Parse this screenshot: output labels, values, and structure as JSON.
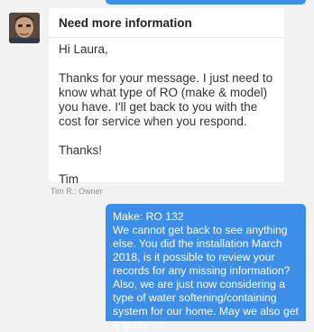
{
  "message": {
    "subject": "Need more information",
    "greeting": "Hi Laura,",
    "paragraph": "Thanks for your message. I just need to know what type of RO (make & model) you have. I'll get back to you with the cost for service when you respond.",
    "thanks": "Thanks!",
    "signature": "Tim"
  },
  "sender_meta": "Tim R.: Owner",
  "reply": {
    "text": "Make: RO 132\nWe cannot get back to see anything else. You did the installation March 2018, is it possible to review your records for any missing information?\nAlso, we are just now considering a type of water softening/containing system for our home. May we also get a quote on"
  },
  "colors": {
    "reply_bubble": "#3d8ee8",
    "background": "#f2f2f2"
  }
}
